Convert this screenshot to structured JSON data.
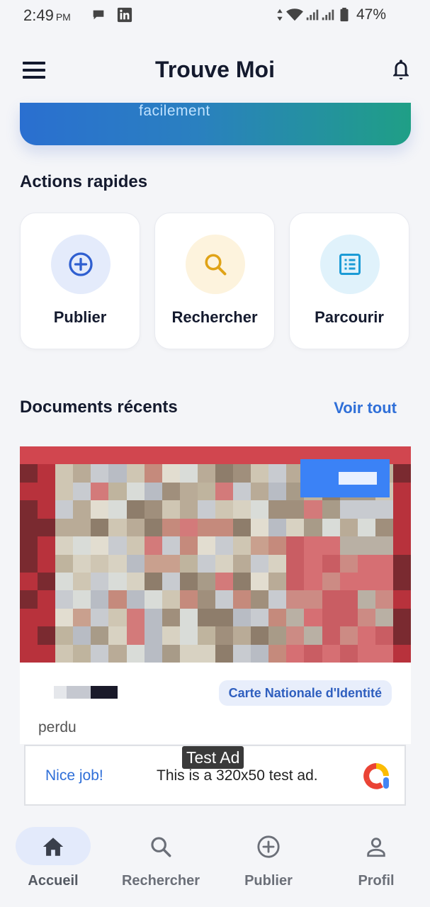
{
  "status_bar": {
    "time": "2:49",
    "ampm": "PM",
    "battery": "47%"
  },
  "header": {
    "title": "Trouve Moi"
  },
  "banner": {
    "text": "facilement"
  },
  "quick_actions": {
    "title": "Actions rapides",
    "items": [
      {
        "label": "Publier",
        "icon": "add-circle-icon",
        "color": "#2f5fd0",
        "bg": "#e4ebfb"
      },
      {
        "label": "Rechercher",
        "icon": "search-icon",
        "color": "#e0a317",
        "bg": "#fdf3dd"
      },
      {
        "label": "Parcourir",
        "icon": "list-icon",
        "color": "#1b9bd6",
        "bg": "#e0f2fb"
      }
    ]
  },
  "recent": {
    "title": "Documents récents",
    "see_all": "Voir tout",
    "documents": [
      {
        "type": "Carte Nationale d'Identité",
        "status": "perdu"
      }
    ]
  },
  "ad": {
    "tag": "Test Ad",
    "cta": "Nice job!",
    "text": "This is a 320x50 test ad."
  },
  "bottom_nav": {
    "items": [
      {
        "label": "Accueil",
        "icon": "home-icon",
        "active": true
      },
      {
        "label": "Rechercher",
        "icon": "search-icon",
        "active": false
      },
      {
        "label": "Publier",
        "icon": "add-circle-icon",
        "active": false
      },
      {
        "label": "Profil",
        "icon": "person-icon",
        "active": false
      }
    ]
  },
  "colors": {
    "accent": "#2f6fd8",
    "background": "#f4f5f8"
  }
}
